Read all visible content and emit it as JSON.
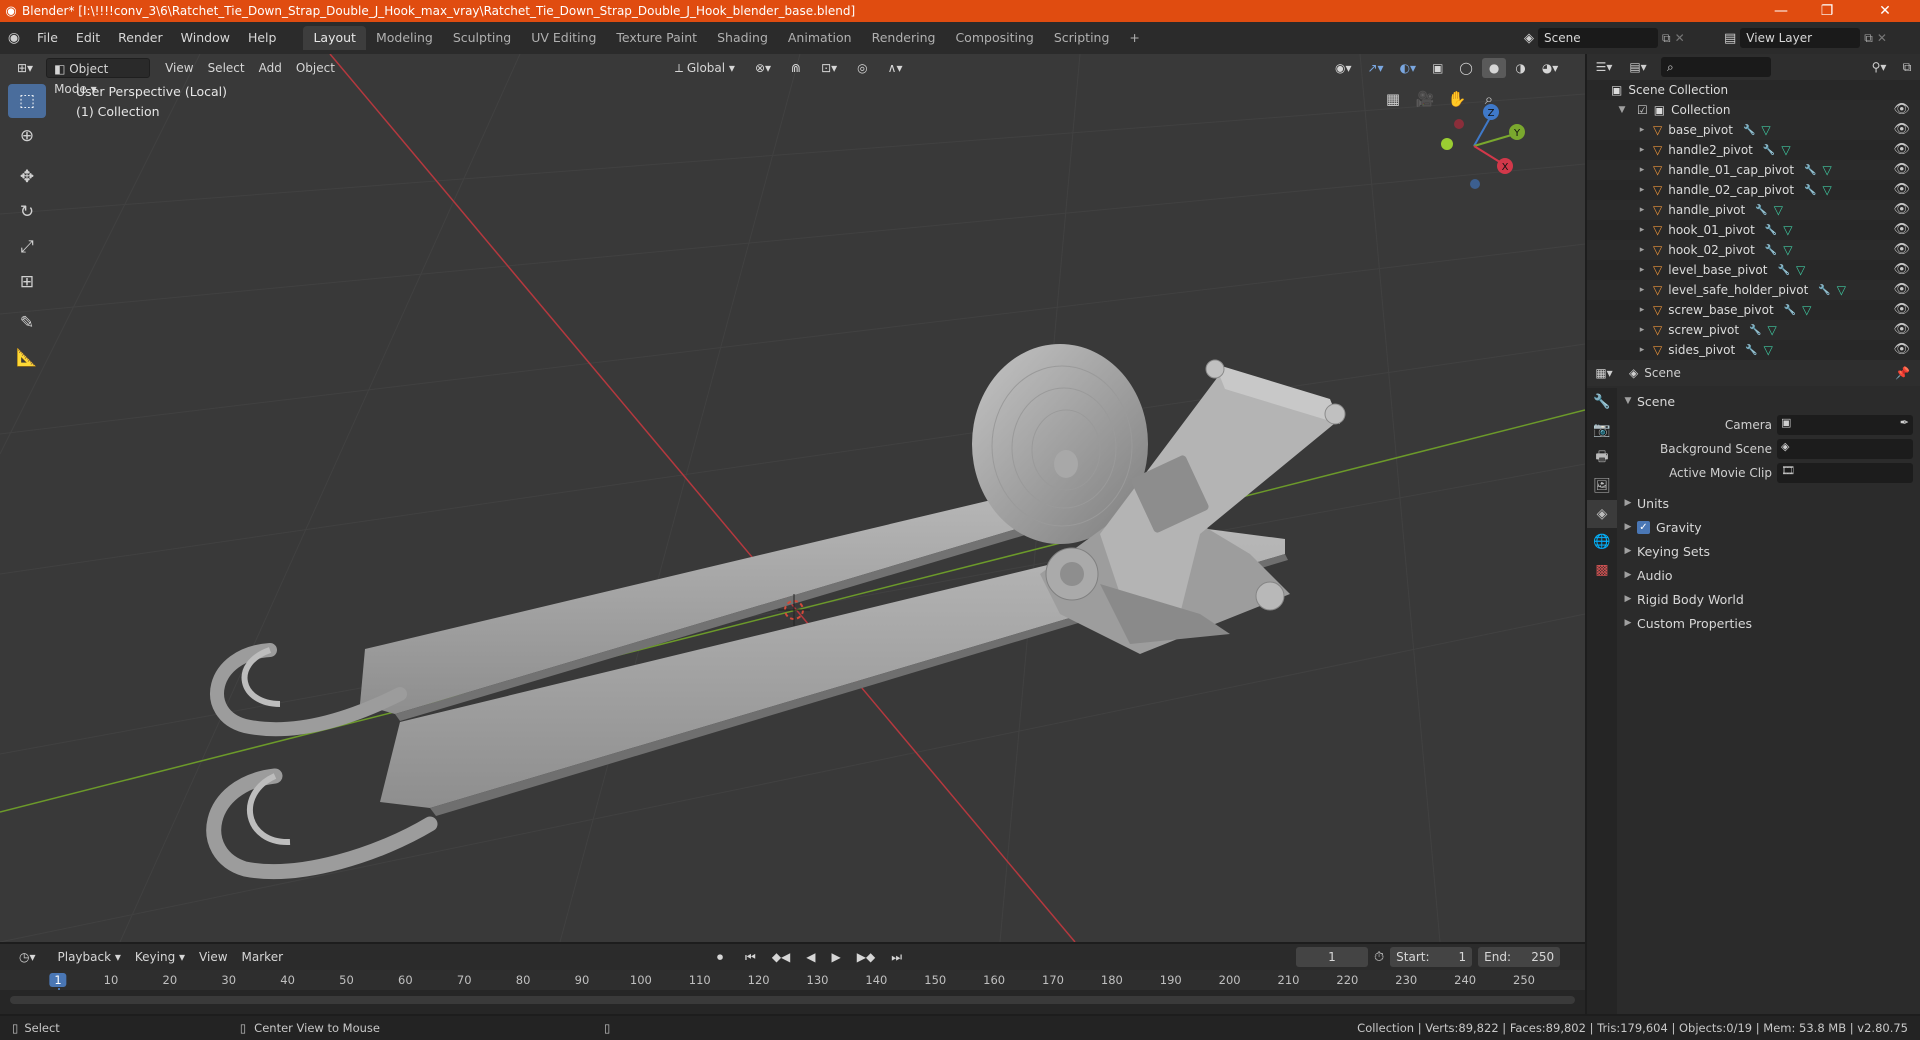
{
  "window": {
    "title": "Blender* [I:\\!!!!conv_3\\6\\Ratchet_Tie_Down_Strap_Double_J_Hook_max_vray\\Ratchet_Tie_Down_Strap_Double_J_Hook_blender_base.blend]",
    "minimize": "—",
    "maximize": "❐",
    "close": "✕"
  },
  "menubar": {
    "items": [
      "File",
      "Edit",
      "Render",
      "Window",
      "Help"
    ],
    "workspaces": [
      "Layout",
      "Modeling",
      "Sculpting",
      "UV Editing",
      "Texture Paint",
      "Shading",
      "Animation",
      "Rendering",
      "Compositing",
      "Scripting"
    ],
    "add_workspace": "+",
    "scene": "Scene",
    "view_layer": "View Layer"
  },
  "viewport": {
    "mode": "Object Mode",
    "menus": [
      "View",
      "Select",
      "Add",
      "Object"
    ],
    "transform_orientation": "Global",
    "info_line1": "User Perspective (Local)",
    "info_line2": "(1) Collection",
    "gizmo_axes": [
      "Z",
      "Y",
      "X"
    ],
    "accent_selected": "#4a6d9c",
    "grid_x_color": "#b5383e",
    "grid_y_color": "#6c9a2a"
  },
  "outliner": {
    "root": "Scene Collection",
    "collection": "Collection",
    "objects": [
      "base_pivot",
      "handle2_pivot",
      "handle_01_cap_pivot",
      "handle_02_cap_pivot",
      "handle_pivot",
      "hook_01_pivot",
      "hook_02_pivot",
      "level_base_pivot",
      "level_safe_holder_pivot",
      "screw_base_pivot",
      "screw_pivot",
      "sides_pivot"
    ]
  },
  "properties": {
    "context": "Scene",
    "panel": "Scene",
    "fields": [
      {
        "label": "Camera"
      },
      {
        "label": "Background Scene"
      },
      {
        "label": "Active Movie Clip"
      }
    ],
    "sections": [
      "Units",
      "Gravity",
      "Keying Sets",
      "Audio",
      "Rigid Body World",
      "Custom Properties"
    ],
    "gravity_checked": true
  },
  "timeline": {
    "menus": [
      "Playback",
      "Keying",
      "View",
      "Marker"
    ],
    "current_frame": "1",
    "start_label": "Start:",
    "start": "1",
    "end_label": "End:",
    "end": "250",
    "ticks": [
      "1",
      "10",
      "20",
      "30",
      "40",
      "50",
      "60",
      "70",
      "80",
      "90",
      "100",
      "110",
      "120",
      "130",
      "140",
      "150",
      "160",
      "170",
      "180",
      "190",
      "200",
      "210",
      "220",
      "230",
      "240",
      "250"
    ]
  },
  "statusbar": {
    "left_action": "Select",
    "mid_action": "Center View to Mouse",
    "stats": "Collection | Verts:89,822 | Faces:89,802 | Tris:179,604 | Objects:0/19 | Mem: 53.8 MB | v2.80.75"
  }
}
